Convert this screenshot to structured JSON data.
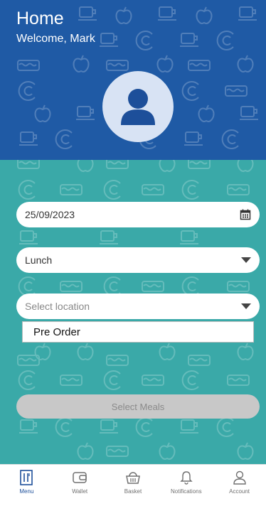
{
  "header": {
    "title": "Home",
    "welcome": "Welcome, Mark"
  },
  "form": {
    "date_value": "25/09/2023",
    "meal_value": "Lunch",
    "location_placeholder": "Select location",
    "dropdown_option": "Pre Order",
    "submit_label": "Select Meals"
  },
  "tabs": [
    {
      "label": "Menu",
      "icon": "menu-icon",
      "active": true
    },
    {
      "label": "Wallet",
      "icon": "wallet-icon",
      "active": false
    },
    {
      "label": "Basket",
      "icon": "basket-icon",
      "active": false
    },
    {
      "label": "Notifications",
      "icon": "bell-icon",
      "active": false
    },
    {
      "label": "Account",
      "icon": "account-icon",
      "active": false
    }
  ],
  "colors": {
    "header_blue": "#1f5aa5",
    "body_teal": "#3aa9a8",
    "active_tab": "#1d4f9a"
  }
}
